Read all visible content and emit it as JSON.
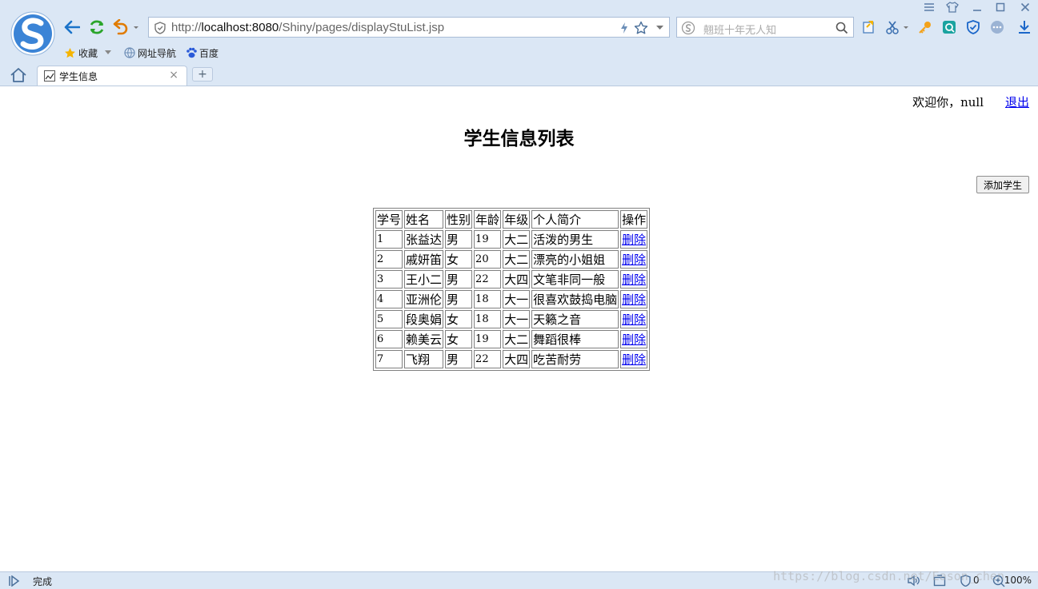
{
  "browser": {
    "url_prefix": "http://",
    "url_host": "localhost:8080",
    "url_path": "/Shiny/pages/displayStuList.jsp",
    "search_placeholder": "翹班十年无人知",
    "bookmarks": [
      {
        "label": "收藏"
      },
      {
        "label": "网址导航"
      },
      {
        "label": "百度"
      }
    ],
    "tab_title": "学生信息",
    "new_tab_label": "+",
    "tab_close": "×"
  },
  "page": {
    "welcome": "欢迎你，null",
    "logout": "退出",
    "title": "学生信息列表",
    "add_button": "添加学生",
    "table": {
      "headers": [
        "学号",
        "姓名",
        "性别",
        "年龄",
        "年级",
        "个人简介",
        "操作"
      ],
      "rows": [
        {
          "id": "1",
          "name": "张益达",
          "gender": "男",
          "age": "19",
          "grade": "大二",
          "intro": "活泼的男生",
          "action": "删除"
        },
        {
          "id": "2",
          "name": "戚妍笛",
          "gender": "女",
          "age": "20",
          "grade": "大二",
          "intro": "漂亮的小姐姐",
          "action": "删除"
        },
        {
          "id": "3",
          "name": "王小二",
          "gender": "男",
          "age": "22",
          "grade": "大四",
          "intro": "文笔非同一般",
          "action": "删除"
        },
        {
          "id": "4",
          "name": "亚洲伦",
          "gender": "男",
          "age": "18",
          "grade": "大一",
          "intro": "很喜欢鼓捣电脑",
          "action": "删除"
        },
        {
          "id": "5",
          "name": "段奥娟",
          "gender": "女",
          "age": "18",
          "grade": "大一",
          "intro": "天籁之音",
          "action": "删除"
        },
        {
          "id": "6",
          "name": "赖美云",
          "gender": "女",
          "age": "19",
          "grade": "大二",
          "intro": "舞蹈很棒",
          "action": "删除"
        },
        {
          "id": "7",
          "name": "飞翔",
          "gender": "男",
          "age": "22",
          "grade": "大四",
          "intro": "吃苦耐劳",
          "action": "删除"
        }
      ]
    }
  },
  "statusbar": {
    "status": "完成",
    "watermark": "https://blog.csdn.net/Eason_chen",
    "count": "0",
    "zoom": "100%"
  },
  "colors": {
    "chrome_bg": "#dbe7f5",
    "link": "#0000ee",
    "nav_arrow": "#1a73c9",
    "refresh": "#2aa52a",
    "undo": "#e07b00"
  }
}
